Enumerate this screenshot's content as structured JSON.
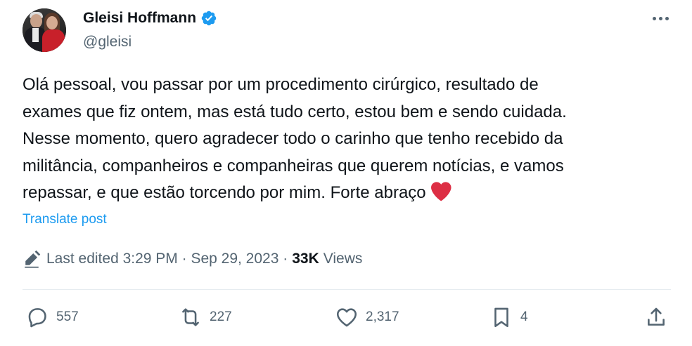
{
  "author": {
    "name": "Gleisi Hoffmann",
    "handle": "@gleisi",
    "verified": true
  },
  "post": {
    "lines": [
      "Olá pessoal, vou passar por um procedimento cirúrgico, resultado de",
      "exames que fiz ontem, mas está tudo certo, estou bem e sendo cuidada.",
      "Nesse momento, quero agradecer todo o carinho que tenho recebido da",
      "militância, companheiros e companheiras que querem notícias, e vamos",
      "repassar, e que estão torcendo por mim. Forte abraço"
    ],
    "emoji": "red-heart"
  },
  "translate_label": "Translate post",
  "meta": {
    "edited_text": "Last edited 3:29 PM · Sep 29, 2023 ·",
    "views_count": "33K",
    "views_label": "Views"
  },
  "actions": {
    "reply_count": "557",
    "retweet_count": "227",
    "like_count": "2,317",
    "bookmark_count": "4"
  },
  "colors": {
    "accent": "#1d9bf0",
    "secondary_text": "#536471",
    "heart": "#e0245e"
  }
}
